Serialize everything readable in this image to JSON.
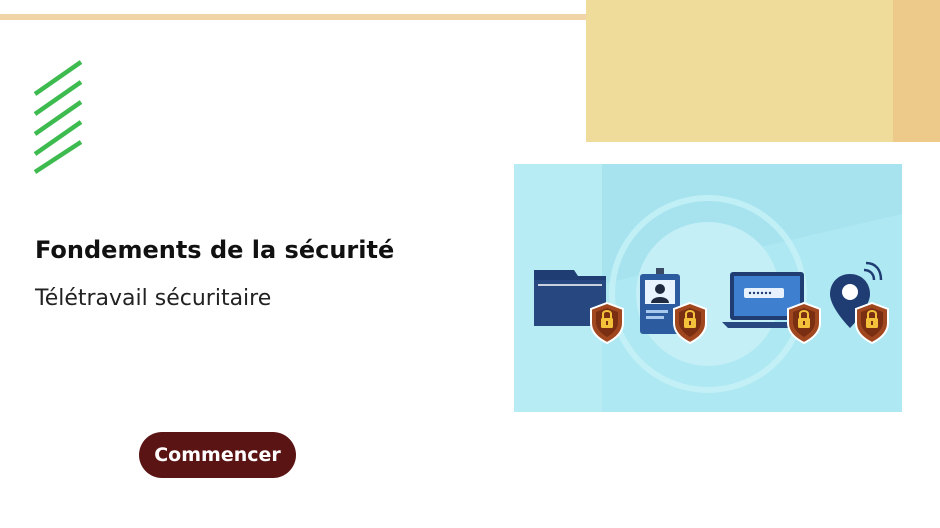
{
  "course": {
    "title": "Fondements de la sécurité",
    "subtitle": "Télétravail sécuritaire",
    "start_label": "Commencer"
  },
  "colors": {
    "button_bg": "#5b1414",
    "accent_green": "#3dbb4f",
    "top_line": "#f0d3a7",
    "deco_block": "#f0dc9a",
    "illustration_bg": "#aee8f2"
  },
  "illustration": {
    "icons": [
      "folder-icon",
      "id-badge-icon",
      "laptop-icon",
      "location-pin-icon",
      "lock-shield-icon"
    ]
  }
}
